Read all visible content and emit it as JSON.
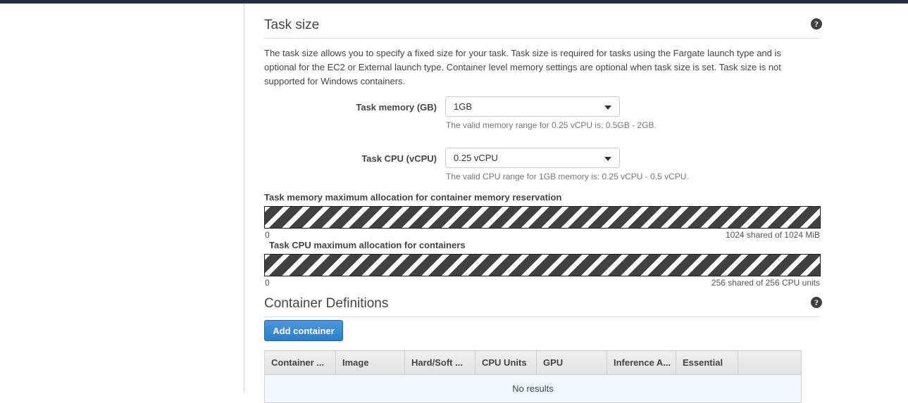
{
  "task_size": {
    "title": "Task size",
    "help_icon": "question-circle-icon",
    "description": "The task size allows you to specify a fixed size for your task. Task size is required for tasks using the Fargate launch type and is optional for the EC2 or External launch type. Container level memory settings are optional when task size is set. Task size is not supported for Windows containers.",
    "memory": {
      "label": "Task memory (GB)",
      "value": "1GB",
      "hint": "The valid memory range for 0.25 vCPU is: 0.5GB - 2GB.",
      "caret_icon": "chevron-down-icon"
    },
    "cpu": {
      "label": "Task CPU (vCPU)",
      "value": "0.25 vCPU",
      "hint": "The valid CPU range for 1GB memory is: 0.25 vCPU - 0.5 vCPU.",
      "caret_icon": "chevron-down-icon"
    }
  },
  "allocation": {
    "memory": {
      "label": "Task memory maximum allocation for container memory reservation",
      "min": "0",
      "max": "1024 shared of 1024 MiB"
    },
    "cpu": {
      "label": "Task CPU maximum allocation for containers",
      "min": "0",
      "max": "256 shared of 256 CPU units"
    }
  },
  "container_definitions": {
    "title": "Container Definitions",
    "help_icon": "question-circle-icon",
    "add_button": "Add container",
    "columns": [
      "Container ...",
      "Image",
      "Hard/Soft ...",
      "CPU Units",
      "GPU",
      "Inference A...",
      "Essential",
      ""
    ],
    "empty_message": "No results"
  },
  "colors": {
    "accent_blue": "#2a7fc9",
    "nav_dark": "#232f3e",
    "stripe_dark": "#414141",
    "empty_row_bg": "#f0f7fd"
  }
}
